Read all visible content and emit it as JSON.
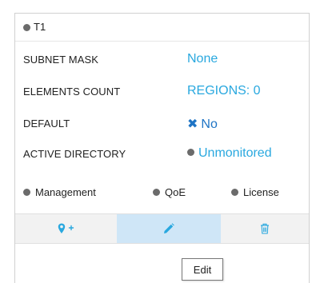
{
  "card": {
    "title": "T1"
  },
  "properties": [
    {
      "label": "SUBNET MASK",
      "value": "None"
    },
    {
      "label": "ELEMENTS COUNT",
      "value": "REGIONS: 0"
    },
    {
      "label": "DEFAULT",
      "value": "No",
      "icon": "x-icon"
    },
    {
      "label": "ACTIVE DIRECTORY",
      "value": "Unmonitored",
      "icon": "status-dot-icon"
    }
  ],
  "status": [
    {
      "label": "Management"
    },
    {
      "label": "QoE"
    },
    {
      "label": "License"
    }
  ],
  "toolbar": {
    "buttons": [
      {
        "name": "add-location",
        "icon": "map-marker-plus-icon"
      },
      {
        "name": "edit",
        "icon": "pencil-icon",
        "active": true
      },
      {
        "name": "delete",
        "icon": "trash-icon"
      }
    ],
    "tooltip": "Edit"
  },
  "colors": {
    "accent": "#29a8df",
    "default_value": "#1e74c5",
    "status_dot": "#6b6b6b",
    "toolbar_bg": "#f2f2f2",
    "active_button_bg": "#cfe6f7"
  }
}
